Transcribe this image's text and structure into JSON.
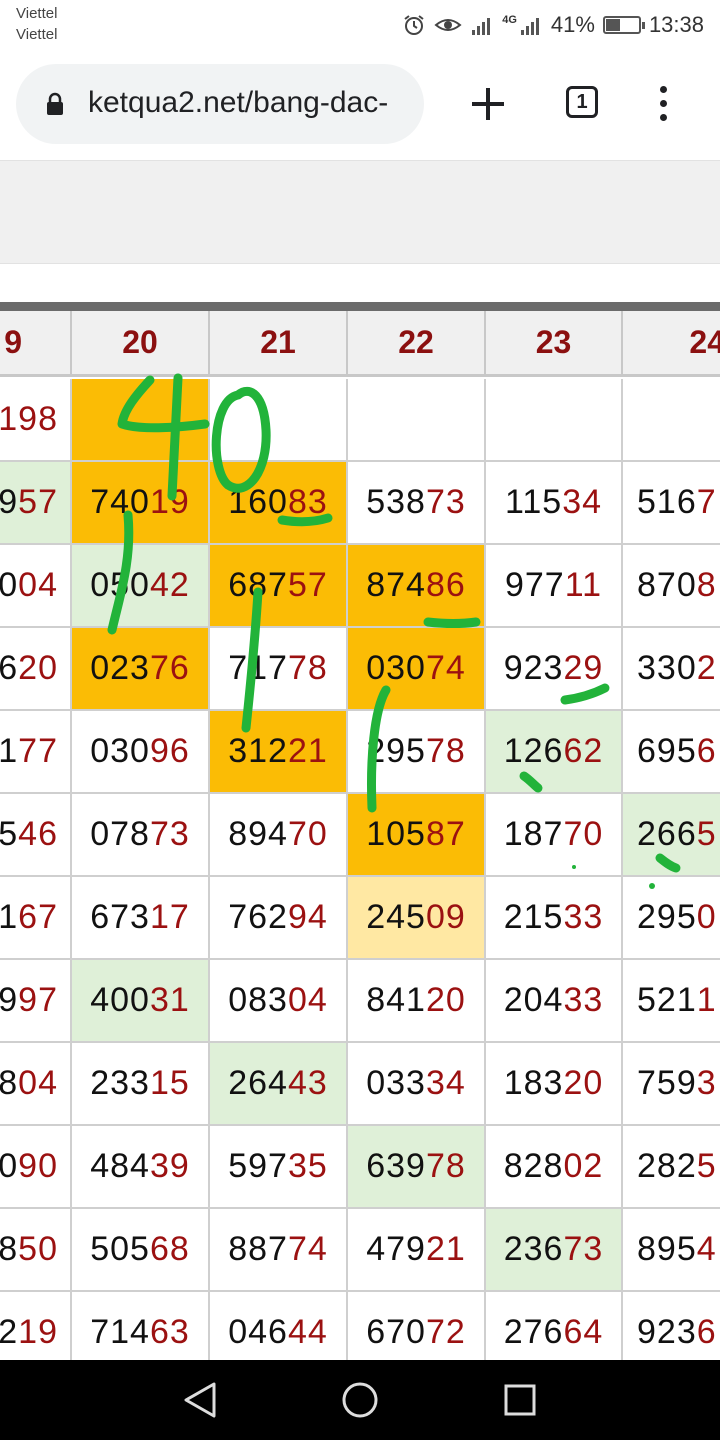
{
  "status_bar": {
    "carrier_1": "Viettel",
    "carrier_2": "Viettel",
    "network": "4G",
    "battery": "41%",
    "battery_level": 0.41,
    "time": "13:38"
  },
  "browser": {
    "url": "ketqua2.net/bang-dac-",
    "tab_count": "1"
  },
  "table": {
    "headers": [
      "9",
      "20",
      "21",
      "22",
      "23",
      "24"
    ],
    "rows": [
      [
        {
          "p": "",
          "s": "198",
          "bg": "white"
        },
        {
          "p": "",
          "s": "",
          "bg": "orange"
        },
        {
          "p": "",
          "s": "",
          "bg": "white"
        },
        {
          "p": "",
          "s": "",
          "bg": "white"
        },
        {
          "p": "",
          "s": "",
          "bg": "white"
        },
        {
          "p": "",
          "s": "",
          "bg": "white"
        }
      ],
      [
        {
          "p": "9",
          "s": "57",
          "bg": "green"
        },
        {
          "p": "740",
          "s": "19",
          "bg": "orange"
        },
        {
          "p": "160",
          "s": "83",
          "bg": "orange"
        },
        {
          "p": "538",
          "s": "73",
          "bg": "white"
        },
        {
          "p": "115",
          "s": "34",
          "bg": "white"
        },
        {
          "p": "516",
          "s": "7",
          "bg": "white"
        }
      ],
      [
        {
          "p": "0",
          "s": "04",
          "bg": "white"
        },
        {
          "p": "050",
          "s": "42",
          "bg": "green"
        },
        {
          "p": "687",
          "s": "57",
          "bg": "orange"
        },
        {
          "p": "874",
          "s": "86",
          "bg": "orange"
        },
        {
          "p": "977",
          "s": "11",
          "bg": "white"
        },
        {
          "p": "870",
          "s": "8",
          "bg": "white"
        }
      ],
      [
        {
          "p": "6",
          "s": "20",
          "bg": "white"
        },
        {
          "p": "023",
          "s": "76",
          "bg": "orange"
        },
        {
          "p": "717",
          "s": "78",
          "bg": "white"
        },
        {
          "p": "030",
          "s": "74",
          "bg": "orange"
        },
        {
          "p": "923",
          "s": "29",
          "bg": "white"
        },
        {
          "p": "330",
          "s": "2",
          "bg": "white"
        }
      ],
      [
        {
          "p": "1",
          "s": "77",
          "bg": "white"
        },
        {
          "p": "030",
          "s": "96",
          "bg": "white"
        },
        {
          "p": "312",
          "s": "21",
          "bg": "orange"
        },
        {
          "p": "295",
          "s": "78",
          "bg": "white"
        },
        {
          "p": "126",
          "s": "62",
          "bg": "green"
        },
        {
          "p": "695",
          "s": "6",
          "bg": "white"
        }
      ],
      [
        {
          "p": "5",
          "s": "46",
          "bg": "white"
        },
        {
          "p": "078",
          "s": "73",
          "bg": "white"
        },
        {
          "p": "894",
          "s": "70",
          "bg": "white"
        },
        {
          "p": "105",
          "s": "87",
          "bg": "orange"
        },
        {
          "p": "187",
          "s": "70",
          "bg": "white"
        },
        {
          "p": "266",
          "s": "5",
          "bg": "green"
        }
      ],
      [
        {
          "p": "1",
          "s": "67",
          "bg": "white"
        },
        {
          "p": "673",
          "s": "17",
          "bg": "white"
        },
        {
          "p": "762",
          "s": "94",
          "bg": "white"
        },
        {
          "p": "245",
          "s": "09",
          "bg": "yellow"
        },
        {
          "p": "215",
          "s": "33",
          "bg": "white"
        },
        {
          "p": "295",
          "s": "0",
          "bg": "white"
        }
      ],
      [
        {
          "p": "9",
          "s": "97",
          "bg": "white"
        },
        {
          "p": "400",
          "s": "31",
          "bg": "green"
        },
        {
          "p": "083",
          "s": "04",
          "bg": "white"
        },
        {
          "p": "841",
          "s": "20",
          "bg": "white"
        },
        {
          "p": "204",
          "s": "33",
          "bg": "white"
        },
        {
          "p": "521",
          "s": "1",
          "bg": "white"
        }
      ],
      [
        {
          "p": "8",
          "s": "04",
          "bg": "white"
        },
        {
          "p": "233",
          "s": "15",
          "bg": "white"
        },
        {
          "p": "264",
          "s": "43",
          "bg": "green"
        },
        {
          "p": "033",
          "s": "34",
          "bg": "white"
        },
        {
          "p": "183",
          "s": "20",
          "bg": "white"
        },
        {
          "p": "759",
          "s": "3",
          "bg": "white"
        }
      ],
      [
        {
          "p": "0",
          "s": "90",
          "bg": "white"
        },
        {
          "p": "484",
          "s": "39",
          "bg": "white"
        },
        {
          "p": "597",
          "s": "35",
          "bg": "white"
        },
        {
          "p": "639",
          "s": "78",
          "bg": "green"
        },
        {
          "p": "828",
          "s": "02",
          "bg": "white"
        },
        {
          "p": "282",
          "s": "5",
          "bg": "white"
        }
      ],
      [
        {
          "p": "8",
          "s": "50",
          "bg": "white"
        },
        {
          "p": "505",
          "s": "68",
          "bg": "white"
        },
        {
          "p": "887",
          "s": "74",
          "bg": "white"
        },
        {
          "p": "479",
          "s": "21",
          "bg": "white"
        },
        {
          "p": "236",
          "s": "73",
          "bg": "green"
        },
        {
          "p": "895",
          "s": "4",
          "bg": "white"
        }
      ],
      [
        {
          "p": "2",
          "s": "19",
          "bg": "white"
        },
        {
          "p": "714",
          "s": "63",
          "bg": "white"
        },
        {
          "p": "046",
          "s": "44",
          "bg": "white"
        },
        {
          "p": "670",
          "s": "72",
          "bg": "white"
        },
        {
          "p": "276",
          "s": "64",
          "bg": "white"
        },
        {
          "p": "923",
          "s": "6",
          "bg": "white"
        }
      ]
    ]
  },
  "colors": {
    "orange": "#fbbc05",
    "green": "#dff0d8",
    "yellow": "#ffe8a3",
    "suffix_red": "#9b1111",
    "ink_green": "#22b33a"
  },
  "annotation": {
    "handwritten_text": "40"
  },
  "nav": {
    "back": "back-icon",
    "home": "home-icon",
    "recents": "recents-icon"
  }
}
